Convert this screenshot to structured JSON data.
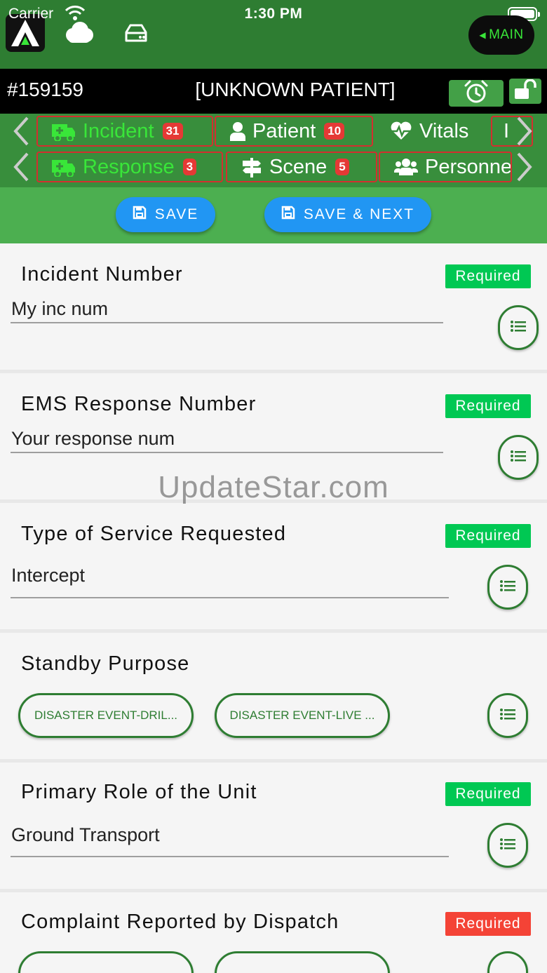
{
  "status_bar": {
    "carrier": "Carrier",
    "time": "1:30 PM"
  },
  "header": {
    "main_button": "MAIN"
  },
  "patient": {
    "id": "#159159",
    "name": "[UNKNOWN PATIENT]"
  },
  "tabs_row1": [
    {
      "label": "Incident",
      "badge": "31",
      "icon": "ambulance-icon",
      "active": true
    },
    {
      "label": "Patient",
      "badge": "10",
      "icon": "user-icon",
      "active": false
    },
    {
      "label": "Vitals",
      "badge": "",
      "icon": "heartbeat-icon",
      "active": false
    }
  ],
  "tabs_row2": [
    {
      "label": "Response",
      "badge": "3",
      "icon": "ambulance-icon",
      "active": true
    },
    {
      "label": "Scene",
      "badge": "5",
      "icon": "signpost-icon",
      "active": false
    },
    {
      "label": "Personnel",
      "badge": "",
      "icon": "users-icon",
      "active": false
    }
  ],
  "save_bar": {
    "save_label": "SAVE",
    "save_next_label": "SAVE & NEXT"
  },
  "fields": [
    {
      "title": "Incident Number",
      "required": "Required",
      "value": "My inc num"
    },
    {
      "title": "EMS Response Number",
      "required": "Required",
      "value": "Your response num"
    },
    {
      "title": "Type of Service Requested",
      "required": "Required",
      "value": "Intercept"
    },
    {
      "title": "Standby Purpose",
      "required": "",
      "chips": [
        "DISASTER EVENT-DRIL...",
        "DISASTER EVENT-LIVE ..."
      ]
    },
    {
      "title": "Primary Role of the Unit",
      "required": "Required",
      "value": "Ground Transport"
    },
    {
      "title": "Complaint Reported by Dispatch",
      "required": "Required"
    }
  ],
  "watermark": "UpdateStar.com",
  "colors": {
    "header_green": "#2e7d32",
    "tab_green": "#388e3c",
    "active_tab_text": "#39e639",
    "badge_red": "#e53935",
    "save_blue": "#2196f3",
    "required_green": "#00c853",
    "required_red": "#f44336"
  }
}
